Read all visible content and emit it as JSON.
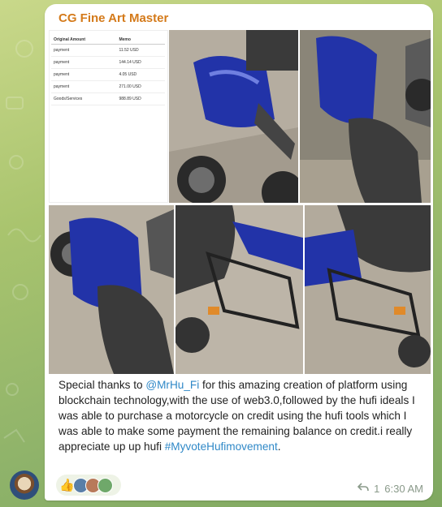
{
  "message": {
    "sender": "CG Fine Art Master",
    "caption_parts": {
      "intro": "Special thanks to ",
      "mention": "@MrHu_Fi",
      "body": " for this amazing creation of platform using blockchain technology,with the use of web3.0,followed by the hufi ideals I was able to purchase a motorcycle on credit using the hufi tools which I was able to make some payment the remaining balance on credit.i really appreciate up up hufi ",
      "hashtag": "#MyvoteHufimovement",
      "end": "."
    },
    "reply_count": "1",
    "time": "6:30 AM",
    "reaction_emoji": "👍"
  },
  "transactions": {
    "headers": [
      "Original Amount",
      "Memo"
    ],
    "rows": [
      {
        "type": "payment",
        "amount": "11.52 USD"
      },
      {
        "type": "payment",
        "amount": "144.14 USD"
      },
      {
        "type": "payment",
        "amount": "4.05 USD"
      },
      {
        "type": "payment",
        "amount": "271.00 USD"
      },
      {
        "type": "Goods/Services",
        "amount": "988.89 USD"
      }
    ]
  },
  "colors": {
    "sender": "#d47a1a",
    "link": "#2f88c7",
    "bike_blue": "#2233a8",
    "pavement": "#b9b2a6"
  },
  "icons": {
    "reply": "reply-arrow-icon"
  }
}
